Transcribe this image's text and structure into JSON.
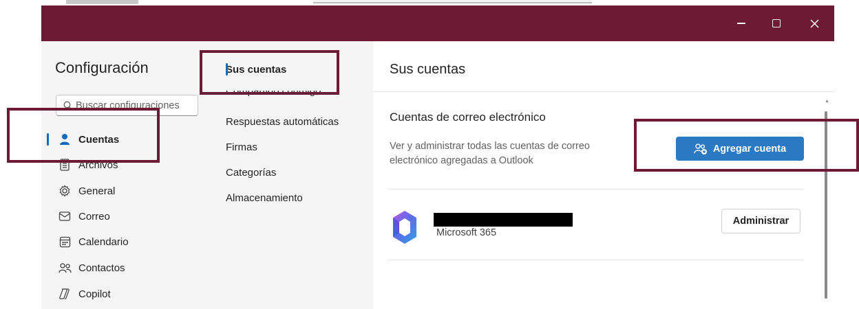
{
  "window": {
    "controls": {
      "minimize": "minimize",
      "maximize": "maximize",
      "close": "close"
    }
  },
  "settings": {
    "title": "Configuración",
    "search_placeholder": "Buscar configuraciones"
  },
  "nav": {
    "items": [
      {
        "label": "Cuentas",
        "icon": "person-icon",
        "active": true
      },
      {
        "label": "Archivos",
        "icon": "file-icon",
        "active": false
      },
      {
        "label": "General",
        "icon": "gear-icon",
        "active": false
      },
      {
        "label": "Correo",
        "icon": "mail-icon",
        "active": false
      },
      {
        "label": "Calendario",
        "icon": "calendar-icon",
        "active": false
      },
      {
        "label": "Contactos",
        "icon": "people-icon",
        "active": false
      },
      {
        "label": "Copilot",
        "icon": "copilot-icon",
        "active": false
      }
    ]
  },
  "subnav": {
    "items": [
      {
        "label": "Sus cuentas",
        "active": true
      },
      {
        "label": "Compartido conmigo",
        "active": false
      },
      {
        "label": "Respuestas automáticas",
        "active": false
      },
      {
        "label": "Firmas",
        "active": false
      },
      {
        "label": "Categorías",
        "active": false
      },
      {
        "label": "Almacenamiento",
        "active": false
      }
    ]
  },
  "main": {
    "title": "Sus cuentas",
    "section_title": "Cuentas de correo electrónico",
    "section_desc": "Ver y administrar todas las cuentas de correo electrónico agregadas a Outlook",
    "add_button": "Agregar cuenta",
    "account": {
      "service": "Microsoft 365",
      "manage_button": "Administrar"
    }
  },
  "colors": {
    "titlebar": "#6d1a34",
    "accent": "#0f6cbd",
    "primary_button": "#2b79c2",
    "highlight_box": "#6d1a34"
  }
}
